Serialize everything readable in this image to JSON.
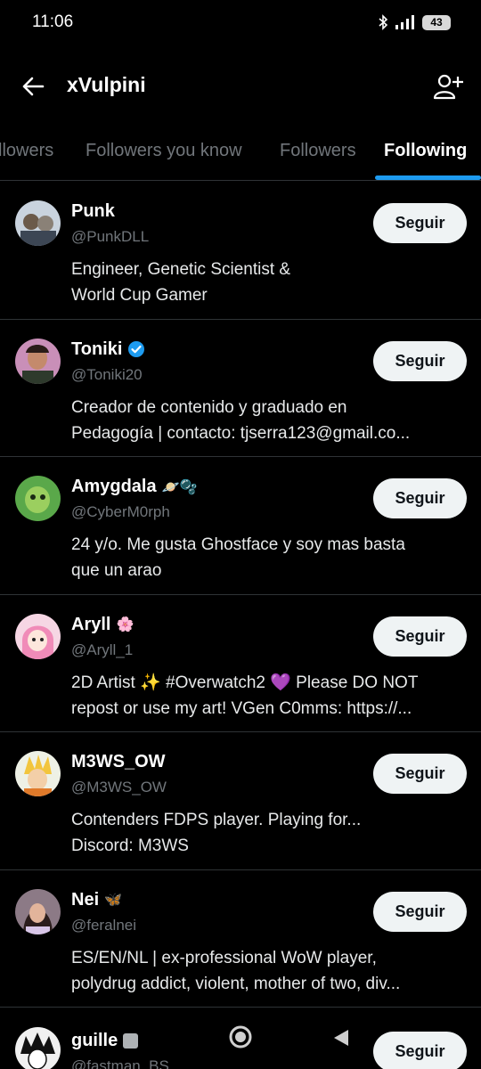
{
  "status": {
    "time": "11:06",
    "battery": "43"
  },
  "header": {
    "title": "xVulpini"
  },
  "tabs": [
    {
      "label": "llowers"
    },
    {
      "label": "Followers you know"
    },
    {
      "label": "Followers"
    },
    {
      "label": "Following"
    }
  ],
  "follow_label": "Seguir",
  "users": [
    {
      "name": "Punk",
      "handle": "@PunkDLL",
      "badge": "",
      "bio": [
        "Engineer, Genetic Scientist &",
        "World Cup Gamer"
      ]
    },
    {
      "name": "Toniki",
      "handle": "@Toniki20",
      "badge": "verified",
      "bio": [
        "Creador de contenido y graduado en",
        "Pedagogía | contacto: tjserra123@gmail.co..."
      ]
    },
    {
      "name": "Amygdala",
      "handle": "@CyberM0rph",
      "badge": "🪐🫧",
      "bio": [
        "24 y/o. Me gusta Ghostface y soy mas basta",
        "que un arao"
      ]
    },
    {
      "name": "Aryll",
      "handle": "@Aryll_1",
      "badge": "🌸",
      "bio": [
        "2D Artist ✨ #Overwatch2 💜 Please DO NOT",
        "repost or use my art! VGen C0mms: https://..."
      ]
    },
    {
      "name": "M3WS_OW",
      "handle": "@M3WS_OW",
      "badge": "",
      "bio": [
        "Contenders FDPS player. Playing for...",
        "Discord: M3WS"
      ]
    },
    {
      "name": "Nei",
      "handle": "@feralnei",
      "badge": "🦋",
      "bio": [
        "ES/EN/NL | ex-professional WoW player,",
        "polydrug addict, violent, mother of two, div..."
      ]
    }
  ],
  "last_user": {
    "name": "guille",
    "handle": "@fastman_BS"
  },
  "colors": {
    "accent": "#1d9bf0",
    "background": "#000000",
    "muted": "#71767b"
  }
}
